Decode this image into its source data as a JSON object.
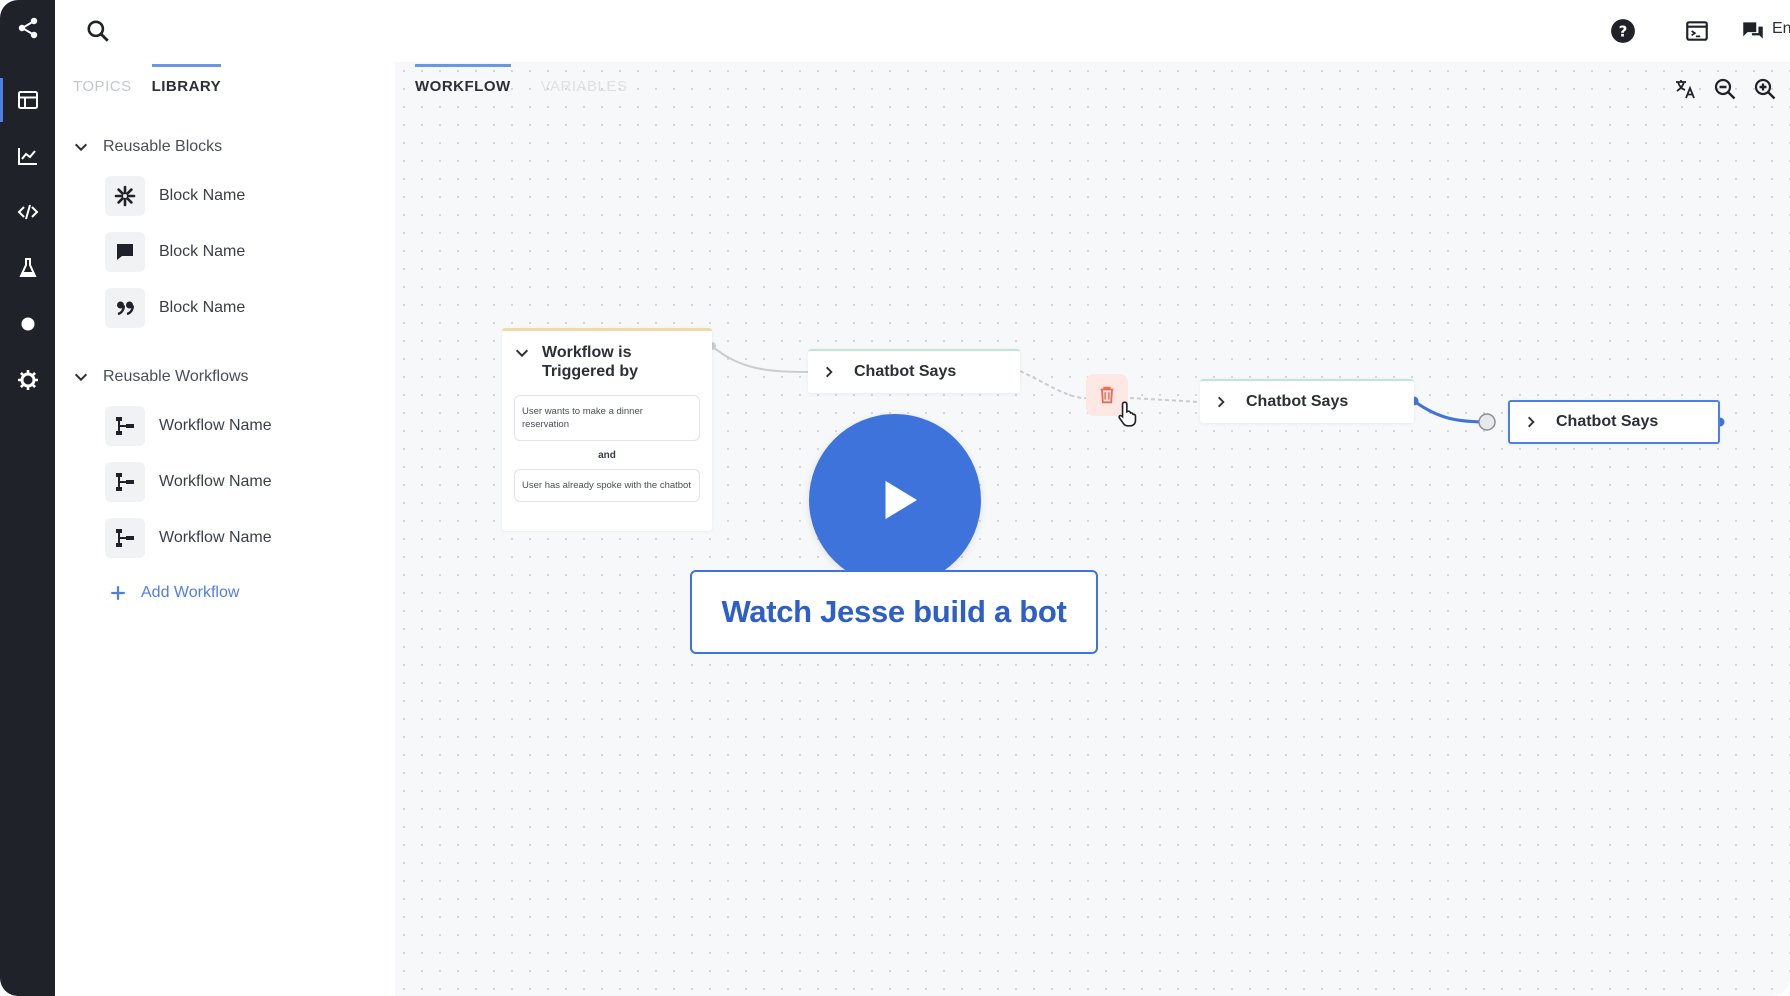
{
  "rail": {
    "items": [
      {
        "name": "share-icon"
      },
      {
        "name": "layout-icon"
      },
      {
        "name": "analytics-icon"
      },
      {
        "name": "code-icon"
      },
      {
        "name": "flask-icon"
      },
      {
        "name": "dot-icon"
      },
      {
        "name": "gear-icon"
      }
    ]
  },
  "topbar": {
    "language_label": "En"
  },
  "panel": {
    "tabs": [
      {
        "label": "TOPICS",
        "active": false
      },
      {
        "label": "LIBRARY",
        "active": true
      }
    ],
    "reusable_blocks": {
      "title": "Reusable Blocks",
      "items": [
        {
          "label": "Block Name",
          "icon": "sparkle-icon"
        },
        {
          "label": "Block Name",
          "icon": "chat-bubble-icon"
        },
        {
          "label": "Block Name",
          "icon": "quote-icon"
        }
      ]
    },
    "reusable_workflows": {
      "title": "Reusable Workflows",
      "items": [
        {
          "label": "Workflow Name",
          "icon": "workflow-icon"
        },
        {
          "label": "Workflow Name",
          "icon": "workflow-icon"
        },
        {
          "label": "Workflow Name",
          "icon": "workflow-icon"
        }
      ]
    },
    "add_workflow_label": "Add Workflow"
  },
  "canvas": {
    "tabs": [
      {
        "label": "WORKFLOW",
        "active": true
      },
      {
        "label": "VARIABLES",
        "active": false
      }
    ],
    "tools": [
      "translate-icon",
      "zoom-out-icon",
      "zoom-in-icon"
    ],
    "trigger": {
      "title": "Workflow is Triggered by",
      "condition_1": "User wants to make a dinner reservation",
      "joiner": "and",
      "condition_2": "User has already spoke with the chatbot"
    },
    "nodes": [
      {
        "label": "Chatbot Says"
      },
      {
        "label": "Chatbot Says"
      },
      {
        "label": "Chatbot Says",
        "selected": true
      }
    ]
  },
  "overlay": {
    "cta_label": "Watch Jesse build a bot"
  },
  "colors": {
    "rail_bg": "#1f2329",
    "accent": "#3f73dc",
    "canvas_bg": "#f7f8f9"
  }
}
